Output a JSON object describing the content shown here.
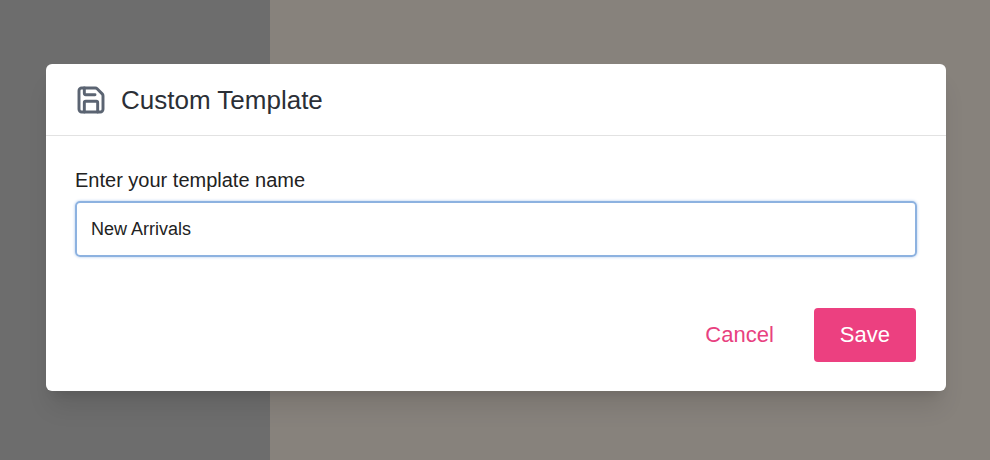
{
  "dialog": {
    "title": "Custom Template",
    "label": "Enter your template name",
    "input": {
      "value": "New Arrivals",
      "focused": true
    },
    "buttons": [
      {
        "label": "Cancel",
        "kind": "text"
      },
      {
        "label": "Save",
        "kind": "primary"
      }
    ]
  }
}
